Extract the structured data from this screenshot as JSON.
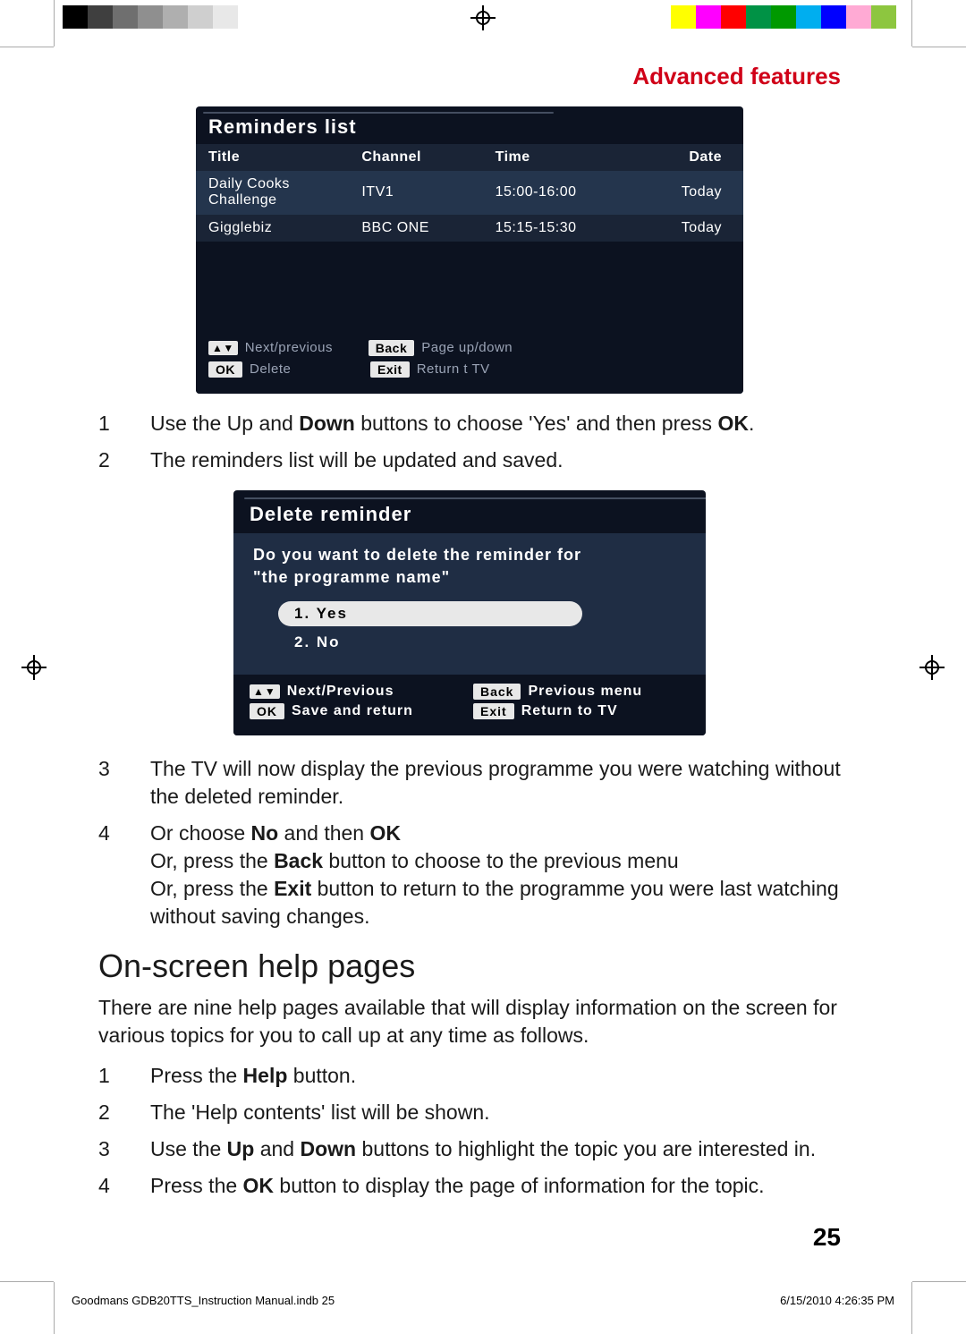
{
  "meta": {
    "domain": "Document"
  },
  "header": {
    "section_title": "Advanced features"
  },
  "screenshot1": {
    "title": "Reminders list",
    "columns": [
      "Title",
      "Channel",
      "Time",
      "Date"
    ],
    "rows": [
      {
        "title": "Daily Cooks Challenge",
        "channel": "ITV1",
        "time": "15:00-16:00",
        "date": "Today"
      },
      {
        "title": "Gigglebiz",
        "channel": "BBC ONE",
        "time": "15:15-15:30",
        "date": "Today"
      }
    ],
    "hints": {
      "arrows": "Next/previous",
      "back_key": "Back",
      "back_label": "Page up/down",
      "ok_key": "OK",
      "ok_label": "Delete",
      "exit_key": "Exit",
      "exit_label": "Return t TV"
    }
  },
  "steps_a": [
    {
      "n": "1",
      "html": "Use the Up and <b>Down</b> buttons to choose 'Yes' and then press <b>OK</b>."
    },
    {
      "n": "2",
      "html": "The reminders list will be updated and saved."
    }
  ],
  "screenshot2": {
    "title": "Delete reminder",
    "question_line1": "Do you want to delete the reminder for",
    "question_line2": "\"the programme name\"",
    "options": [
      {
        "n": "1.",
        "label": "Yes",
        "selected": true
      },
      {
        "n": "2.",
        "label": "No",
        "selected": false
      }
    ],
    "hints": {
      "arrows": "Next/Previous",
      "back_key": "Back",
      "back_label": "Previous menu",
      "ok_key": "OK",
      "ok_label": "Save and return",
      "exit_key": "Exit",
      "exit_label": "Return to TV"
    }
  },
  "steps_b": [
    {
      "n": "3",
      "html": "The TV will now display the previous programme you were watching without the deleted reminder."
    },
    {
      "n": "4",
      "html": "Or choose <b>No</b> and then <b>OK</b><br>Or, press the <b>Back</b> button to choose to the previous menu<br>Or, press the <b>Exit</b> button to return to the programme you were last watching without saving changes."
    }
  ],
  "help_section": {
    "heading": "On-screen help pages",
    "intro": "There are nine help pages available that will display information on the screen for various topics for you to call up at any time as follows.",
    "steps": [
      {
        "n": "1",
        "html": "Press the <b>Help</b> button."
      },
      {
        "n": "2",
        "html": "The 'Help contents' list will be shown."
      },
      {
        "n": "3",
        "html": "Use the <b>Up</b> and <b>Down</b> buttons to highlight the topic you are interested in."
      },
      {
        "n": "4",
        "html": "Press the <b>OK</b> button to display the page of information for the topic."
      }
    ]
  },
  "page_number": "25",
  "print_footer": {
    "file": "Goodmans GDB20TTS_Instruction Manual.indb   25",
    "datetime": "6/15/2010   4:26:35 PM"
  },
  "colorbars": {
    "left": [
      "#000000",
      "#3f3f3f",
      "#6f6f6f",
      "#8f8f8f",
      "#afafaf",
      "#cfcfcf",
      "#e8e8e8",
      "#ffffff",
      "#ffffff",
      "#ffffff"
    ],
    "right": [
      "#ffffff",
      "#ffff00",
      "#ff00ff",
      "#ff0000",
      "#009245",
      "#009900",
      "#00aeef",
      "#0000ff",
      "#ffaad4",
      "#8dc63f"
    ]
  }
}
